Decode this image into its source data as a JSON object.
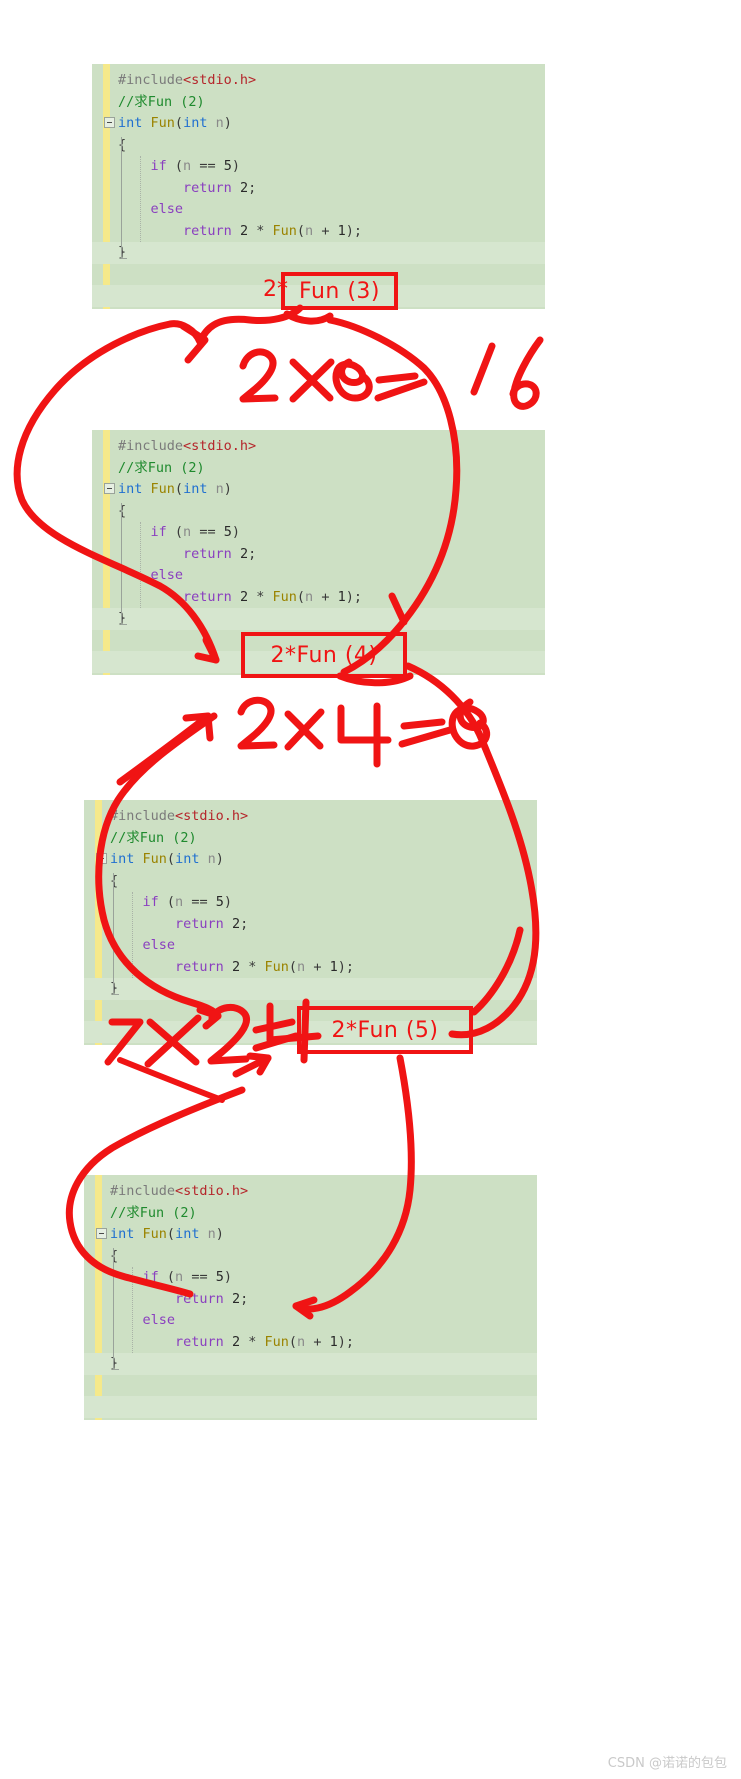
{
  "page": {
    "background": "#ffffff",
    "watermark": "CSDN @诺诺的包包"
  },
  "code_theme": {
    "background": "#cde0c4",
    "alt_row_background": "#d6e6cf",
    "change_bar": "#f5e98a",
    "preprocessor": "#7b7b7b",
    "header_name": "#b5262b",
    "comment": "#1f8a2e",
    "keyword": "#1f6fd0",
    "function": "#9a8300",
    "control": "#8a3fbf",
    "identifier": "#4a4a4a",
    "annotation_red": "#f01414"
  },
  "code": {
    "lines": [
      {
        "id": "line-include",
        "tokens": [
          {
            "text": "#include",
            "cls": "c-pre"
          },
          {
            "text": "<stdio.h>",
            "cls": "c-hdr"
          }
        ]
      },
      {
        "id": "line-comment",
        "tokens": [
          {
            "text": "//求Fun (2)",
            "cls": "c-cmt"
          }
        ]
      },
      {
        "id": "line-signature",
        "tokens": [
          {
            "text": "int",
            "cls": "c-kw"
          },
          {
            "text": " ",
            "cls": "c-punc"
          },
          {
            "text": "Fun",
            "cls": "c-fn"
          },
          {
            "text": "(",
            "cls": "c-punc"
          },
          {
            "text": "int",
            "cls": "c-kw"
          },
          {
            "text": " ",
            "cls": "c-punc"
          },
          {
            "text": "n",
            "cls": "c-var"
          },
          {
            "text": ")",
            "cls": "c-punc"
          }
        ]
      },
      {
        "id": "line-open-brace",
        "tokens": [
          {
            "text": "{",
            "cls": "c-punc"
          }
        ]
      },
      {
        "id": "line-if",
        "tokens": [
          {
            "text": "    ",
            "cls": "c-punc"
          },
          {
            "text": "if",
            "cls": "c-ctl"
          },
          {
            "text": " (",
            "cls": "c-punc"
          },
          {
            "text": "n",
            "cls": "c-var"
          },
          {
            "text": " == ",
            "cls": "c-punc"
          },
          {
            "text": "5",
            "cls": "c-num"
          },
          {
            "text": ")",
            "cls": "c-punc"
          }
        ]
      },
      {
        "id": "line-return-base",
        "tokens": [
          {
            "text": "        ",
            "cls": "c-punc"
          },
          {
            "text": "return",
            "cls": "c-ctl"
          },
          {
            "text": " ",
            "cls": "c-punc"
          },
          {
            "text": "2",
            "cls": "c-num"
          },
          {
            "text": ";",
            "cls": "c-punc"
          }
        ]
      },
      {
        "id": "line-else",
        "tokens": [
          {
            "text": "    ",
            "cls": "c-punc"
          },
          {
            "text": "else",
            "cls": "c-ctl"
          }
        ]
      },
      {
        "id": "line-return-recursive",
        "tokens": [
          {
            "text": "        ",
            "cls": "c-punc"
          },
          {
            "text": "return",
            "cls": "c-ctl"
          },
          {
            "text": " ",
            "cls": "c-punc"
          },
          {
            "text": "2",
            "cls": "c-num"
          },
          {
            "text": " ",
            "cls": "c-punc"
          },
          {
            "text": "*",
            "cls": "c-punc"
          },
          {
            "text": " ",
            "cls": "c-punc"
          },
          {
            "text": "Fun",
            "cls": "c-fn"
          },
          {
            "text": "(",
            "cls": "c-punc"
          },
          {
            "text": "n",
            "cls": "c-var"
          },
          {
            "text": " + ",
            "cls": "c-punc"
          },
          {
            "text": "1",
            "cls": "c-num"
          },
          {
            "text": ");",
            "cls": "c-punc"
          }
        ]
      },
      {
        "id": "line-close-brace",
        "tokens": [
          {
            "text": "}",
            "cls": "c-punc"
          }
        ]
      }
    ]
  },
  "blocks": [
    {
      "id": "code-block-1",
      "label": "code-screenshot-1"
    },
    {
      "id": "code-block-2",
      "label": "code-screenshot-2"
    },
    {
      "id": "code-block-3",
      "label": "code-screenshot-3"
    },
    {
      "id": "code-block-4",
      "label": "code-screenshot-4"
    }
  ],
  "annotations": {
    "boxes": [
      {
        "id": "annot-fun3",
        "prefix": "2*",
        "boxed": "Fun (3)"
      },
      {
        "id": "annot-fun4",
        "prefix": "",
        "boxed": "2*Fun (4)"
      },
      {
        "id": "annot-fun5",
        "prefix": "",
        "boxed": "2*Fun (5)"
      }
    ],
    "handwriting": [
      {
        "id": "hand-2x8",
        "text": "2×8=16"
      },
      {
        "id": "hand-2x4",
        "text": "2x4 =8"
      },
      {
        "id": "hand-2x2",
        "text": "2x2=4"
      }
    ]
  }
}
